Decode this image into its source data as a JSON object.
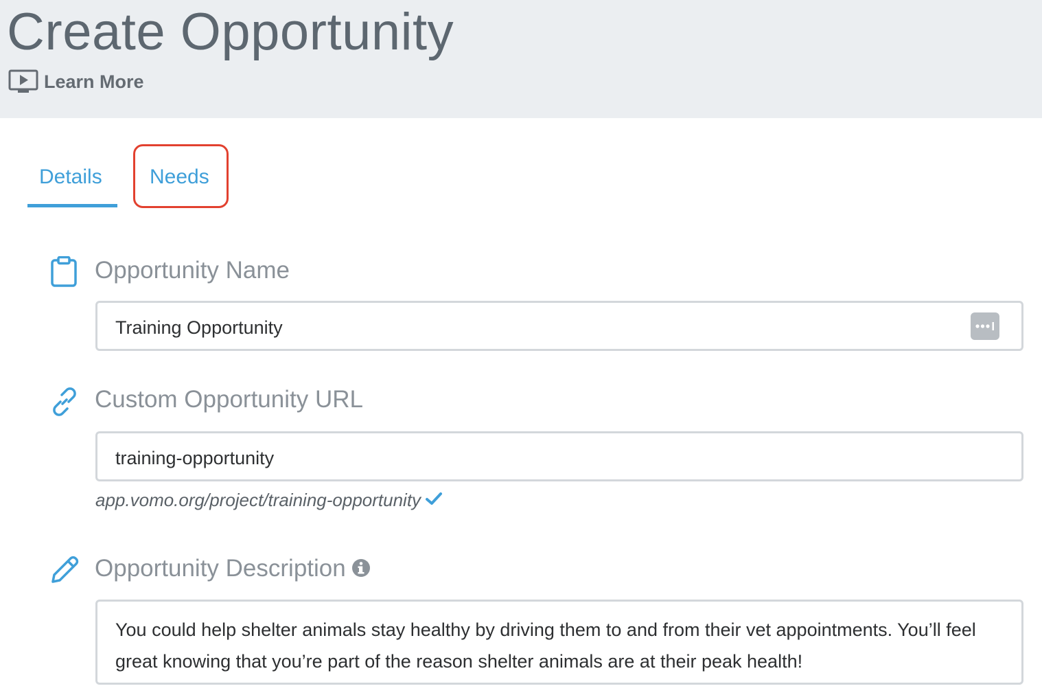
{
  "header": {
    "title": "Create Opportunity",
    "learn_more": "Learn More",
    "learn_more_icon": "video-play-icon"
  },
  "tabs": [
    {
      "label": "Details",
      "active": true
    },
    {
      "label": "Needs",
      "active": false,
      "highlighted": true
    }
  ],
  "colors": {
    "accent": "#3f9fd9",
    "highlight": "#e2412f",
    "header_bg": "#ebeef1"
  },
  "fields": {
    "name": {
      "label": "Opportunity Name",
      "icon": "clipboard-icon",
      "value": "Training Opportunity",
      "action_icon": "more-options-icon"
    },
    "url": {
      "label": "Custom Opportunity URL",
      "icon": "link-icon",
      "value": "training-opportunity",
      "preview": "app.vomo.org/project/training-opportunity",
      "status_icon": "checkmark-icon"
    },
    "description": {
      "label": "Opportunity Description",
      "icon": "pencil-icon",
      "info_icon": "info-icon",
      "value": "You could help shelter animals stay healthy by driving them to and from their vet appointments. You’ll feel great knowing that you’re part of the reason shelter animals are at their peak health!"
    }
  }
}
